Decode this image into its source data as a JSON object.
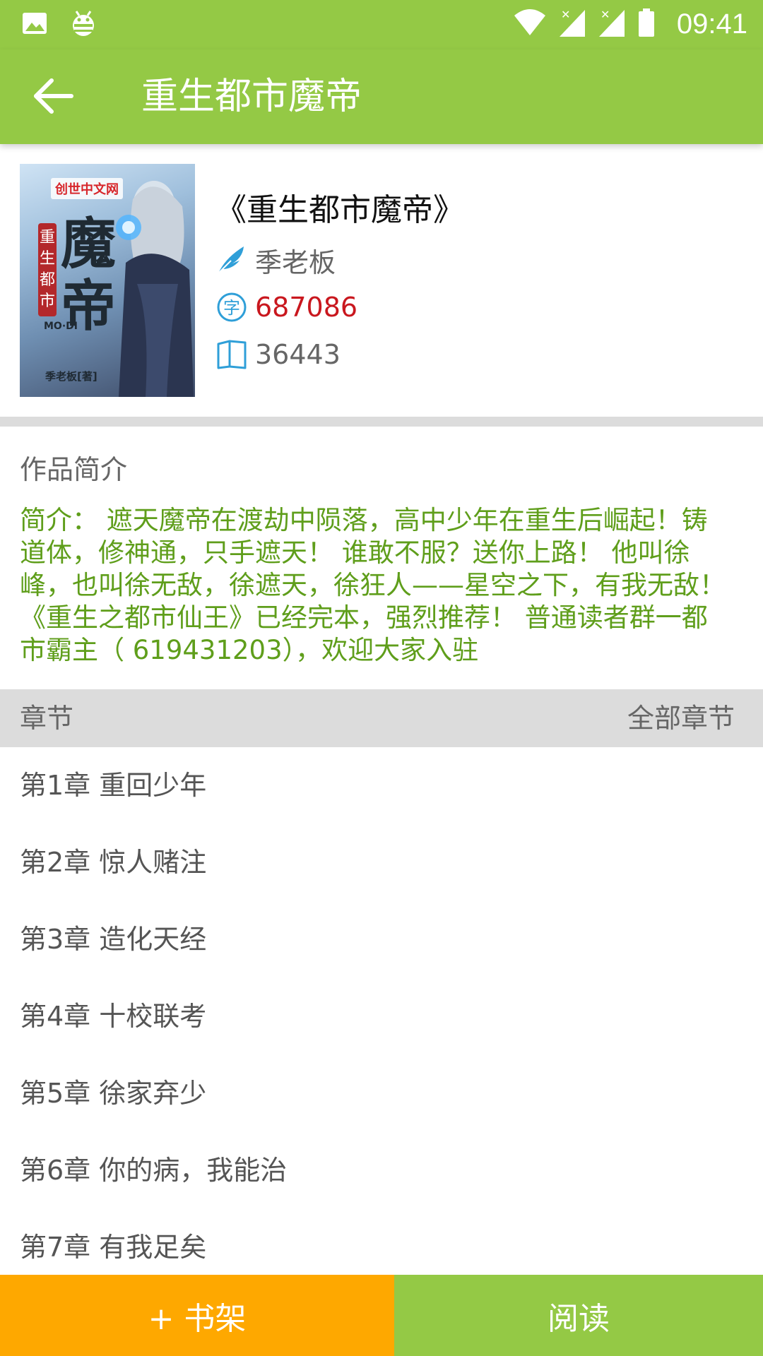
{
  "status_bar": {
    "time": "09:41",
    "icons": [
      "image-icon",
      "android-debug-icon",
      "wifi-icon",
      "signal-icon",
      "signal-icon",
      "battery-icon"
    ]
  },
  "app_bar": {
    "back_icon": "arrow-left-icon",
    "title": "重生都市魔帝"
  },
  "book": {
    "title": "《重生都市魔帝》",
    "author": "季老板",
    "word_count": "687086",
    "chapter_count": "36443",
    "cover": {
      "logo_text": "创世中文网",
      "small_title": "重生都市",
      "big_title": "魔帝",
      "latin": "MO·DI",
      "author_line": "季老板[著]"
    },
    "icons": {
      "author": "feather-icon",
      "words": "character-icon",
      "chapters": "book-icon"
    }
  },
  "synopsis": {
    "heading": "作品简介",
    "text": "  简介： 遮天魔帝在渡劫中陨落，高中少年在重生后崛起！铸道体，修神通，只手遮天！ 谁敢不服？送你上路！ 他叫徐峰，也叫徐无敌，徐遮天，徐狂人——星空之下，有我无敌！ 《重生之都市仙王》已经完本，强烈推荐！ 普通读者群一都市霸主（ 619431203），欢迎大家入驻"
  },
  "chapters": {
    "header_label": "章节",
    "all_link": "全部章节",
    "items": [
      "第1章 重回少年",
      "第2章 惊人赌注",
      "第3章 造化天经",
      "第4章 十校联考",
      "第5章 徐家弃少",
      "第6章 你的病，我能治",
      "第7章 有我足矣"
    ]
  },
  "actions": {
    "add_shelf": "+ 书架",
    "read": "阅读"
  },
  "colors": {
    "primary": "#94c945",
    "accent": "#fea800",
    "synopsis_text": "#5f9e1b",
    "word_count": "#c9171e",
    "icon_blue": "#2f9fd8"
  }
}
